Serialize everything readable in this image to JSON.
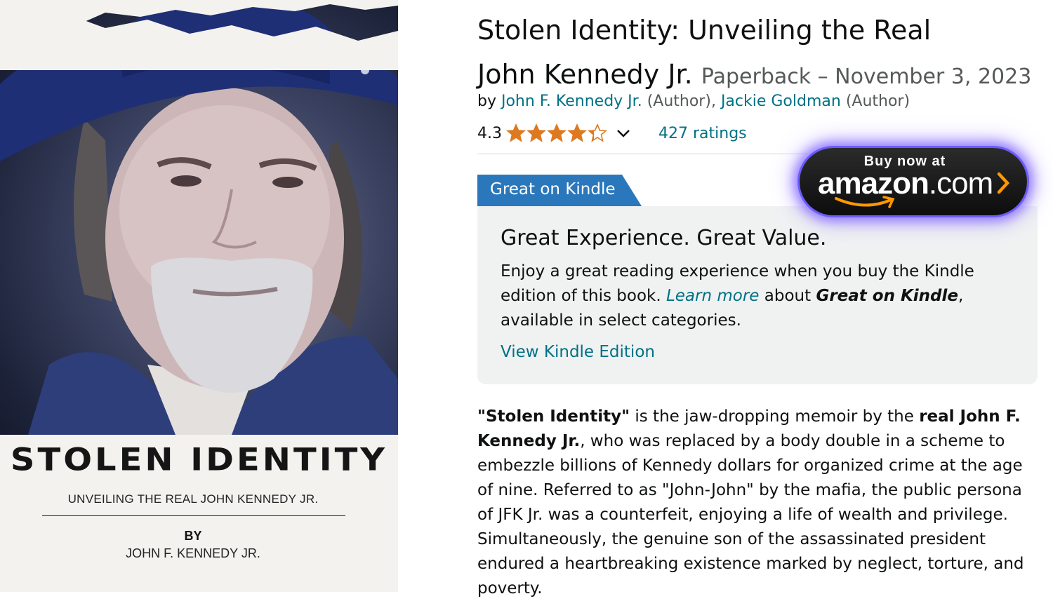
{
  "cover": {
    "title": "STOLEN IDENTITY",
    "subtitle": "UNVEILING THE REAL JOHN KENNEDY JR.",
    "by": "BY",
    "author": "JOHN F. KENNEDY JR."
  },
  "product": {
    "title_line1": "Stolen Identity: Unveiling the Real",
    "title_line2": "John Kennedy Jr.",
    "format_date": "Paperback – November 3, 2023",
    "by_label": "by",
    "authors": [
      {
        "name": "John F. Kennedy Jr.",
        "role": "(Author)"
      },
      {
        "name": "Jackie Goldman",
        "role": "(Author)"
      }
    ],
    "rating": "4.3",
    "rating_value": 4.3,
    "ratings_count": "427 ratings"
  },
  "kindle": {
    "tag": "Great on Kindle",
    "heading": "Great Experience. Great Value.",
    "body_before": "Enjoy a great reading experience when you buy the Kindle edition of this book. ",
    "learn_more": "Learn more",
    "body_mid": " about ",
    "great_on_kindle": "Great on Kindle",
    "body_after": ", available in select categories.",
    "view_link": "View Kindle Edition"
  },
  "description": {
    "q_title": "\"Stolen Identity\"",
    "t1": " is the jaw-dropping memoir by the ",
    "b1": "real John F. Kennedy Jr.",
    "t2": ", who was replaced by a body double in a scheme to embezzle billions of Kennedy dollars for organized crime at the age of nine. Referred to as \"John-John\" by the mafia, the public persona of JFK Jr. was a counterfeit, enjoying a life of wealth and privilege. Simultaneously, the genuine son of the assassinated president endured a heartbreaking existence marked by neglect, torture, and poverty."
  },
  "amazon_button": {
    "small": "Buy now at",
    "brand": "amazon",
    "dot": ".",
    "tld": "com"
  },
  "colors": {
    "link": "#007185",
    "star": "#de7921",
    "kindle_tag": "#2a78bb",
    "kindle_box": "#f0f2f2",
    "button_glow": "#6b5cff",
    "amazon_orange": "#ff9900"
  },
  "icons": [
    "star-icon",
    "chevron-down-icon",
    "amazon-smile-icon",
    "chevron-right-icon"
  ]
}
